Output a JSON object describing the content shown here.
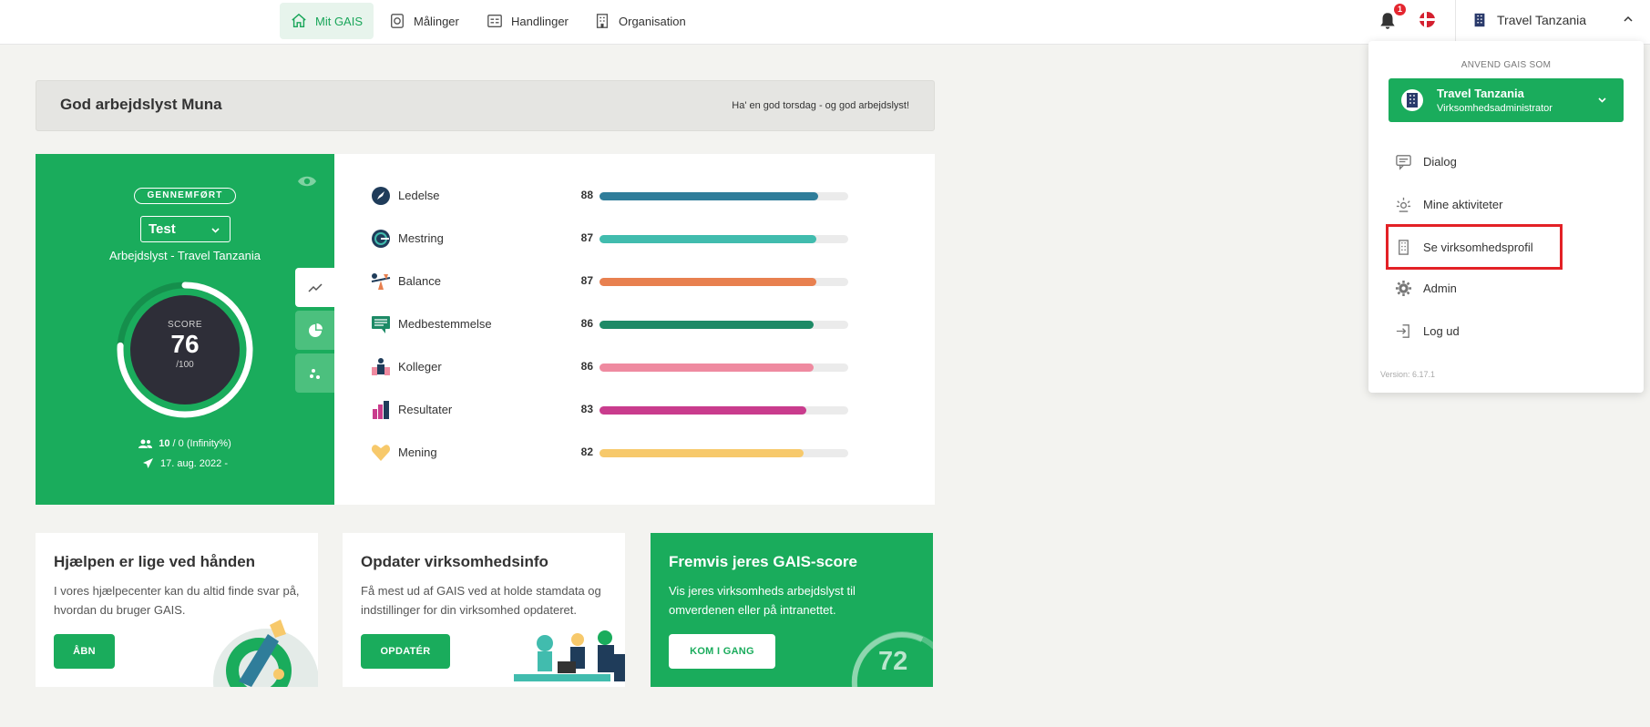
{
  "nav": {
    "items": [
      {
        "label": "Mit GAIS",
        "icon": "home-icon",
        "active": true
      },
      {
        "label": "Målinger",
        "icon": "survey-icon",
        "active": false
      },
      {
        "label": "Handlinger",
        "icon": "actions-icon",
        "active": false
      },
      {
        "label": "Organisation",
        "icon": "building-icon",
        "active": false
      }
    ],
    "notifications_count": "1",
    "language": "Dansk",
    "user_org": "Travel Tanzania"
  },
  "greeting": {
    "title": "God arbejdslyst Muna",
    "message": "Ha' en god torsdag - og god arbejdslyst!"
  },
  "score_panel": {
    "status": "GENNEMFØRT",
    "survey": "Test",
    "subtitle": "Arbejdslyst - Travel Tanzania",
    "score_label": "SCORE",
    "score": "76",
    "score_max": "/100",
    "score_fraction": 0.76,
    "participants_count": "10",
    "participants_rest": " / 0 (Infinity%)",
    "date": "17. aug. 2022 -",
    "colors": {
      "panel": "#1aac5c",
      "gauge_dark": "#2e2e38"
    }
  },
  "dimensions": [
    {
      "label": "Ledelse",
      "value": "88",
      "fraction": 0.88,
      "color": "#2f7d9a",
      "icon": "compass-icon"
    },
    {
      "label": "Mestring",
      "value": "87",
      "fraction": 0.87,
      "color": "#41bcae",
      "icon": "target-icon"
    },
    {
      "label": "Balance",
      "value": "87",
      "fraction": 0.87,
      "color": "#e8804f",
      "icon": "balance-icon"
    },
    {
      "label": "Medbestemmelse",
      "value": "86",
      "fraction": 0.86,
      "color": "#1d8a66",
      "icon": "speech-icon"
    },
    {
      "label": "Kolleger",
      "value": "86",
      "fraction": 0.86,
      "color": "#ef8aa0",
      "icon": "colleagues-icon"
    },
    {
      "label": "Resultater",
      "value": "83",
      "fraction": 0.83,
      "color": "#c93c8d",
      "icon": "results-icon"
    },
    {
      "label": "Mening",
      "value": "82",
      "fraction": 0.82,
      "color": "#f7c96b",
      "icon": "heart-icon"
    }
  ],
  "cards": [
    {
      "title": "Hjælpen er lige ved hånden",
      "text": "I vores hjælpecenter kan du altid finde svar på, hvordan du bruger GAIS.",
      "button": "ÅBN"
    },
    {
      "title": "Opdater virksomhedsinfo",
      "text": "Få mest ud af GAIS ved at holde stamdata og indstillinger for din virksomhed opdateret.",
      "button": "OPDATÉR"
    },
    {
      "title": "Fremvis jeres GAIS-score",
      "text": "Vis jeres virksomheds arbejdslyst til omverdenen eller på intranettet.",
      "button": "KOM I GANG",
      "score": "72"
    }
  ],
  "dropdown": {
    "heading": "ANVEND GAIS SOM",
    "org_name": "Travel Tanzania",
    "org_role": "Virksomhedsadministrator",
    "items": [
      {
        "label": "Dialog",
        "icon": "chat-icon"
      },
      {
        "label": "Mine aktiviteter",
        "icon": "activity-icon"
      },
      {
        "label": "Se virksomhedsprofil",
        "icon": "building-icon",
        "highlighted": true
      },
      {
        "label": "Admin",
        "icon": "gear-icon"
      },
      {
        "label": "Log ud",
        "icon": "logout-icon"
      }
    ],
    "version": "Version: 6.17.1"
  }
}
